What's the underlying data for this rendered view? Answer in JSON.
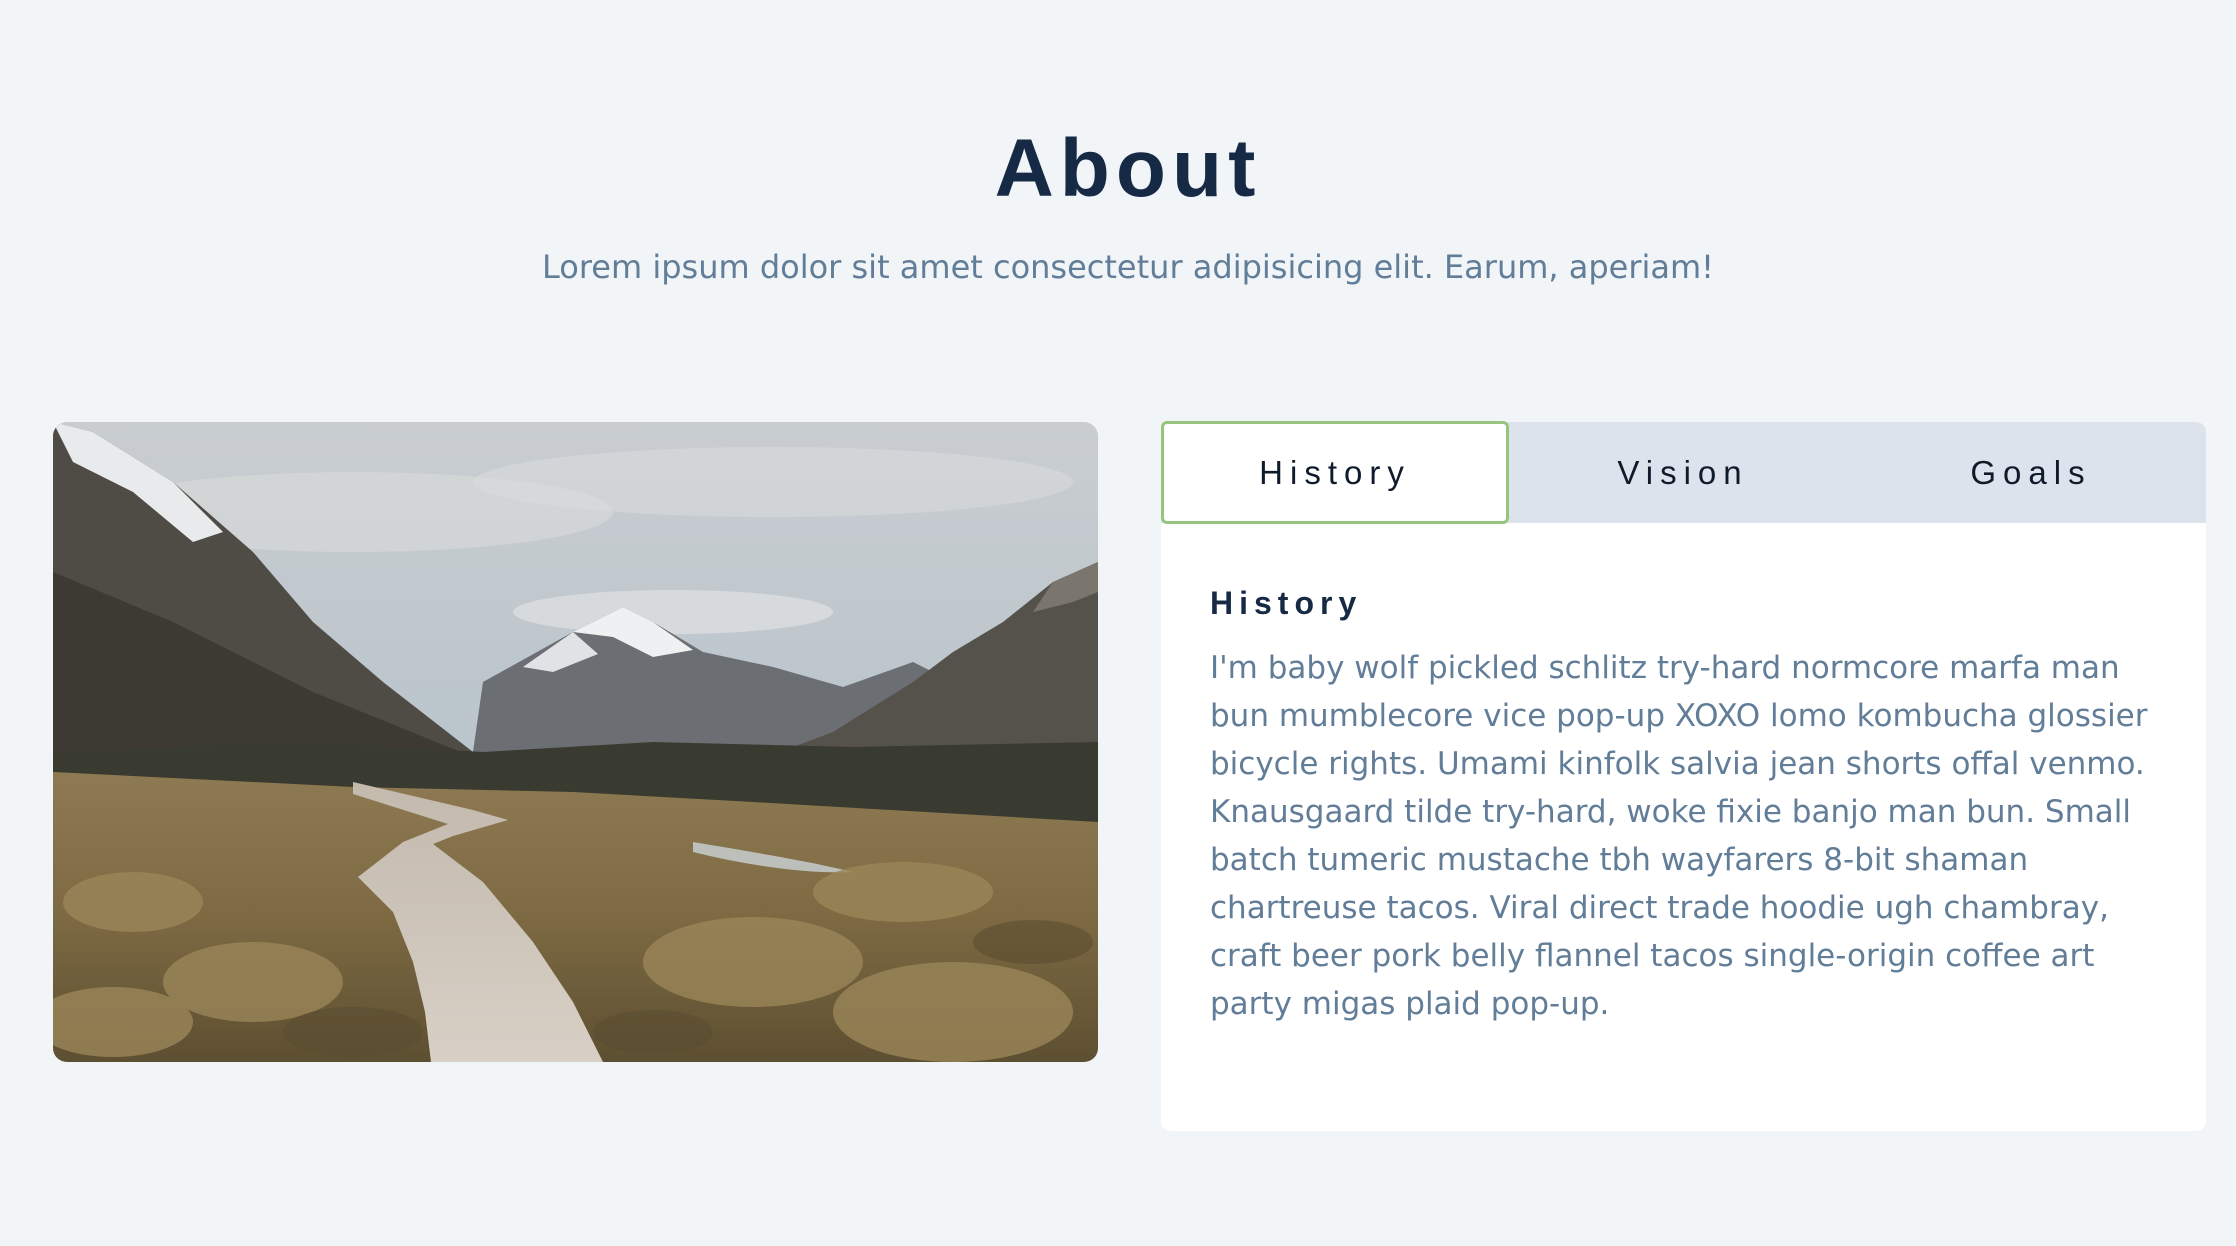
{
  "section": {
    "title": "About",
    "subtitle": "Lorem ipsum dolor sit amet consectetur adipisicing elit. Earum, aperiam!"
  },
  "image": {
    "subject": "mountain-valley-boardwalk-photo"
  },
  "tabs": [
    {
      "label": "History",
      "active": true
    },
    {
      "label": "Vision",
      "active": false
    },
    {
      "label": "Goals",
      "active": false
    }
  ],
  "content": {
    "heading": "History",
    "text": "I'm baby wolf pickled schlitz try-hard normcore marfa man bun mumblecore vice pop-up XOXO lomo kombucha glossier bicycle rights. Umami kinfolk salvia jean shorts offal venmo. Knausgaard tilde try-hard, woke fixie banjo man bun. Small batch tumeric mustache tbh wayfarers 8-bit shaman chartreuse tacos. Viral direct trade hoodie ugh chambray, craft beer pork belly flannel tacos single-origin coffee art party migas plaid pop-up."
  },
  "colors": {
    "background": "#f1f5f8",
    "title": "#172a45",
    "body_text": "#617d98",
    "tab_bar": "#dde3ec",
    "active_tab_border": "#96c67e"
  }
}
